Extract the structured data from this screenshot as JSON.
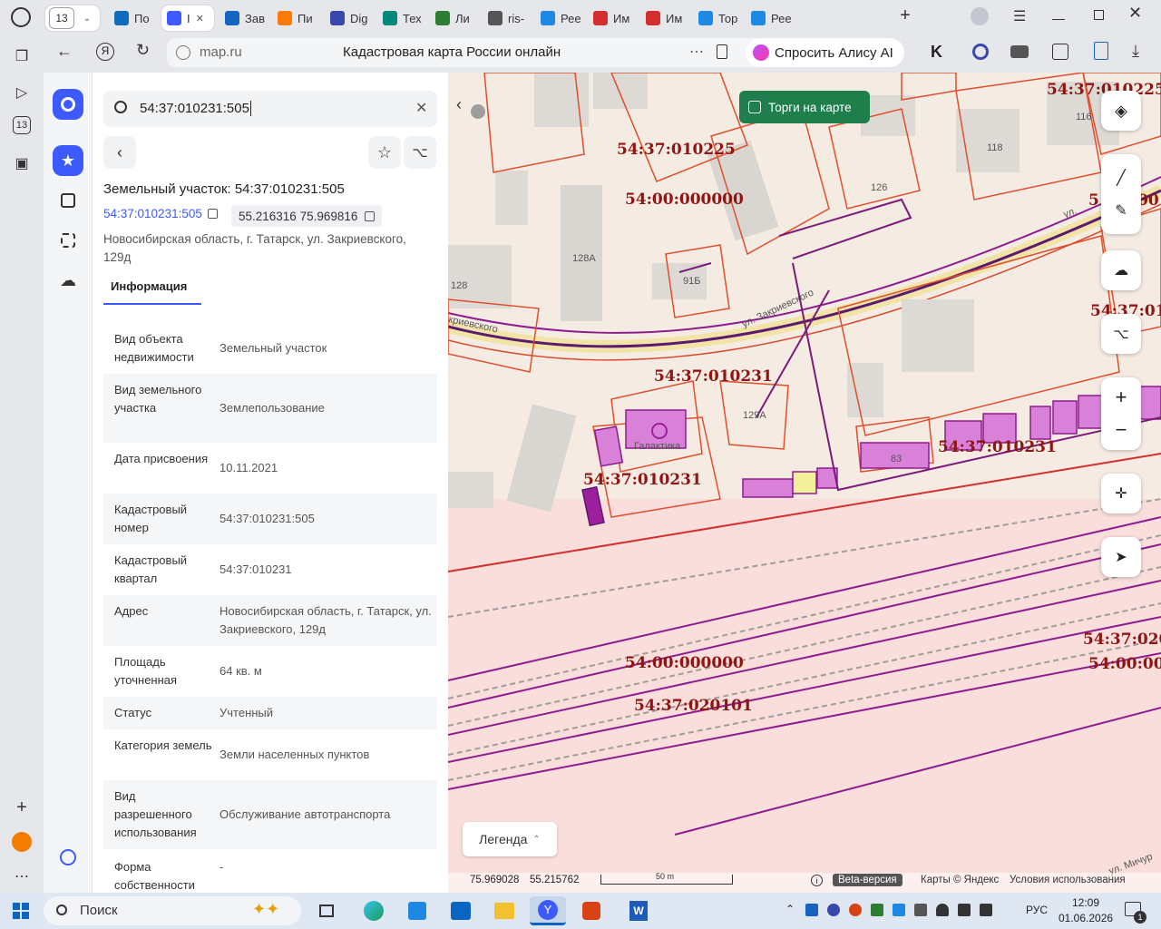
{
  "browser": {
    "tab_count": "13",
    "tabs": [
      {
        "label": "По",
        "color": "#0f6cbd"
      },
      {
        "label": "I",
        "color": "#3d5afe",
        "active": true
      },
      {
        "label": "Зав",
        "color": "#1565c0"
      },
      {
        "label": "Пи",
        "color": "#ff7a00"
      },
      {
        "label": "Dig",
        "color": "#3949ab"
      },
      {
        "label": "Тех",
        "color": "#00897b"
      },
      {
        "label": "Ли",
        "color": "#2e7d32"
      },
      {
        "label": "ris-",
        "color": "#555555"
      },
      {
        "label": "Рее",
        "color": "#1e88e5"
      },
      {
        "label": "Им",
        "color": "#d32f2f"
      },
      {
        "label": "Им",
        "color": "#d32f2f"
      },
      {
        "label": "Тор",
        "color": "#1e88e5"
      },
      {
        "label": "Рее",
        "color": "#1e88e5"
      }
    ],
    "url": "map.ru",
    "page_title": "Кадастровая карта России онлайн",
    "alice_label": "Спросить Алису AI"
  },
  "search": {
    "value": "54:37:010231:505"
  },
  "object": {
    "title": "Земельный участок: 54:37:010231:505",
    "cad_link": "54:37:010231:505",
    "coords": "55.216316 75.969816",
    "address": "Новосибирская область, г. Татарск, ул. Закриевского, 129д",
    "tab_label": "Информация"
  },
  "info_rows": [
    {
      "key": "Вид объекта недвижимости",
      "value": "Земельный участок"
    },
    {
      "key": "Вид земельного участка",
      "value": "Землепользование"
    },
    {
      "key": "Дата присвоения",
      "value": "10.11.2021"
    },
    {
      "key": "Кадастровый номер",
      "value": "54:37:010231:505"
    },
    {
      "key": "Кадастровый квартал",
      "value": "54:37:010231"
    },
    {
      "key": "Адрес",
      "value": "Новосибирская область, г. Татарск, ул. Закриевского, 129д"
    },
    {
      "key": "Площадь уточненная",
      "value": "64 кв. м"
    },
    {
      "key": "Статус",
      "value": "Учтенный"
    },
    {
      "key": "Категория земель",
      "value": "Земли населенных пунктов"
    },
    {
      "key": "Вид разрешенного использования",
      "value": "Обслуживание автотранспорта"
    },
    {
      "key": "Форма собственности",
      "value": "-"
    }
  ],
  "map": {
    "auction_toggle": "Торги на карте",
    "legend_label": "Легенда",
    "coord_lon": "75.969028",
    "coord_lat": "55.215762",
    "scale_label": "50 m",
    "beta_label": "Beta-версия",
    "attribution": "Карты © Яндекс",
    "terms": "Условия использования",
    "labels": {
      "q1": "54:37:010225",
      "q2": "54:00:000000",
      "q3": "54:37:010231",
      "q4": "54:37:010231",
      "q5": "54:37:010231",
      "q6": "54:00:000000",
      "q7": "54:37:020101",
      "q8": "54:37:010225",
      "q9": "54:37:01",
      "q10": "54:37:020",
      "q11": "54:00:00",
      "q12": "5",
      "q13": "00"
    },
    "buildings": {
      "b116": "116",
      "b118": "118",
      "b126": "126",
      "b128a": "128А",
      "b128": "128",
      "b91b": "91Б",
      "b129a": "129А",
      "b83": "83"
    },
    "streets": {
      "s1": "ул. Закриевского",
      "s2": "криевского",
      "s3": "ул.",
      "s4": "ул. Мичур"
    },
    "poi": "Галактика"
  },
  "taskbar": {
    "search_label": "Поиск",
    "lang": "РУС",
    "time": "12:09",
    "date": "01.06.2026",
    "notif_count": "1"
  }
}
